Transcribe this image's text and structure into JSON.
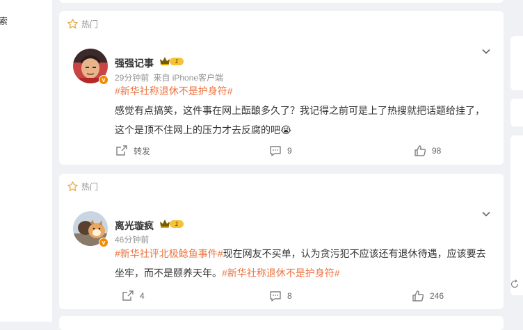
{
  "left_nav": {
    "search_fragment": "索"
  },
  "hot_label": "热门",
  "posts": [
    {
      "author": "强强记事",
      "level": "1",
      "verified_mark": "v",
      "time": "29分钟前",
      "source": "来自 iPhone客户端",
      "topic_tag": "#新华社称退休不是护身符#",
      "text_line1": "感觉有点搞笑，这件事在网上酝酿多久了？我记得之前可是上了热搜就把话题给挂了，",
      "text_line2": "这个是顶不住网上的压力才去反腐的吧",
      "emoji": "😭",
      "repost_label": "转发",
      "comment_count": "9",
      "like_count": "98"
    },
    {
      "author": "离光璇疯",
      "level": "1",
      "verified_mark": "v",
      "time": "46分钟前",
      "topic_tag_1": "#新华社评北极鲶鱼事件#",
      "text_part1": "现在网友不买单，认为贪污犯不应该还有退休待遇，应该要去",
      "text_part2": "坐牢，而不是颐养天年。",
      "topic_tag_2": "#新华社称退休不是护身符#",
      "repost_count": "4",
      "comment_count": "8",
      "like_count": "246"
    }
  ],
  "colors": {
    "topic": "#eb7340",
    "meta": "#939393",
    "accent_orange": "#f08a00",
    "level_gold": "#f5c33a"
  },
  "icons": [
    "star-icon",
    "chevron-down-icon",
    "repost-icon",
    "comment-icon",
    "like-icon",
    "crown-icon",
    "refresh-icon"
  ]
}
